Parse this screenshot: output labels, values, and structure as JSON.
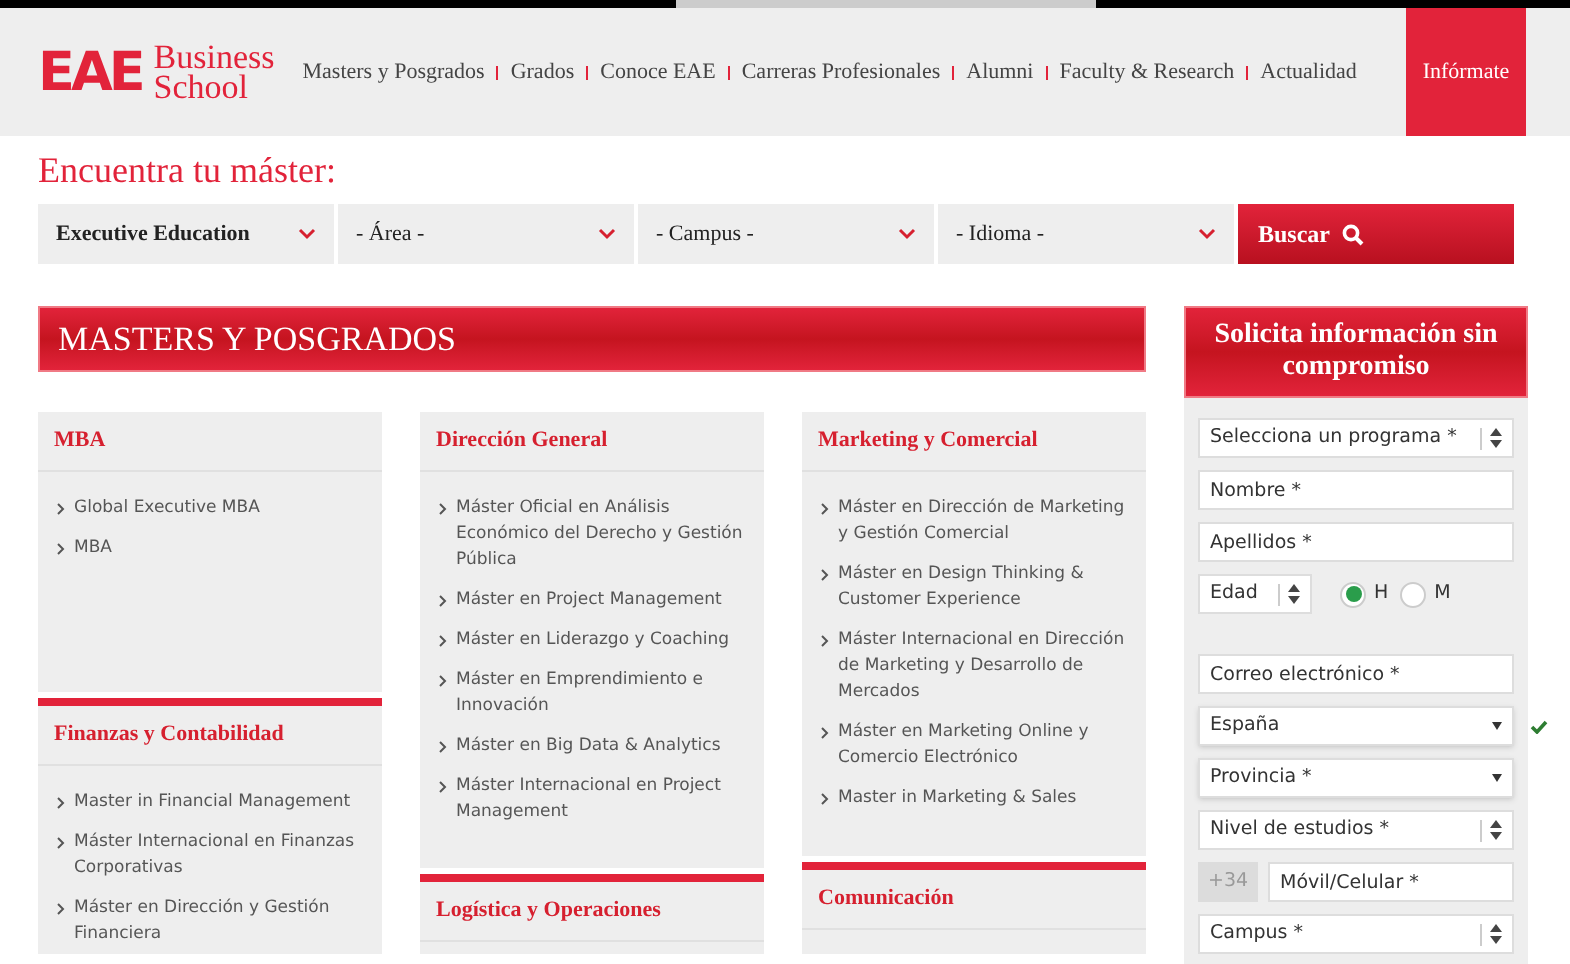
{
  "header": {
    "logo": {
      "mark": "EAE",
      "line1": "Business",
      "line2": "School"
    },
    "nav": [
      {
        "label": "Masters y Posgrados"
      },
      {
        "label": "Grados"
      },
      {
        "label": "Conoce EAE"
      },
      {
        "label": "Carreras Profesionales"
      },
      {
        "label": "Alumni"
      },
      {
        "label": "Faculty & Research"
      },
      {
        "label": "Actualidad"
      }
    ],
    "cta": "Infórmate"
  },
  "finder": {
    "title": "Encuentra tu máster:",
    "filters": [
      {
        "value": "Executive Education",
        "bold": true
      },
      {
        "value": "- Área -",
        "bold": false
      },
      {
        "value": "- Campus -",
        "bold": false
      },
      {
        "value": "- Idioma -",
        "bold": false
      }
    ],
    "button": "Buscar"
  },
  "masters": {
    "title": "MASTERS Y POSGRADOS",
    "columns": [
      [
        {
          "title": "MBA",
          "items": [
            "Global Executive MBA",
            "MBA"
          ]
        },
        {
          "title": "Finanzas y Contabilidad",
          "items": [
            "Master in Financial Management",
            "Máster Internacional en Finanzas Corporativas",
            "Máster en Dirección y Gestión Financiera"
          ]
        }
      ],
      [
        {
          "title": "Dirección General",
          "items": [
            "Máster Oficial en Análisis Económico del Derecho y Gestión Pública",
            "Máster en Project Management",
            "Máster en Liderazgo y Coaching",
            "Máster en Emprendimiento e Innovación",
            "Máster en Big Data & Analytics",
            "Máster Internacional en Project Management"
          ]
        },
        {
          "title": "Logística y Operaciones"
        }
      ],
      [
        {
          "title": "Marketing y Comercial",
          "items": [
            "Máster en Dirección de Marketing y Gestión Comercial",
            "Máster en Design Thinking & Customer Experience",
            "Máster Internacional en Dirección de Marketing y Desarrollo de Mercados",
            "Máster en Marketing Online y Comercio Electrónico",
            "Master in Marketing & Sales"
          ]
        },
        {
          "title": "Comunicación"
        }
      ]
    ]
  },
  "form": {
    "title": "Solicita información sin compromiso",
    "fields": [
      {
        "kind": "spinner",
        "value": "Selecciona un programa *"
      },
      {
        "kind": "input",
        "placeholder": "Nombre *"
      },
      {
        "kind": "input",
        "placeholder": "Apellidos *"
      },
      {
        "kind": "age",
        "value": "Edad",
        "options": [
          {
            "label": "H",
            "selected": true
          },
          {
            "label": "M",
            "selected": false
          }
        ]
      },
      {
        "kind": "input",
        "placeholder": "Correo electrónico *"
      },
      {
        "kind": "dropdown",
        "value": "España",
        "valid": true
      },
      {
        "kind": "dropdown",
        "value": "Provincia *",
        "valid": false
      },
      {
        "kind": "spinner",
        "value": "Nivel de estudios *"
      },
      {
        "kind": "phone",
        "prefix": "+34",
        "placeholder": "Móvil/Celular *"
      },
      {
        "kind": "spinner",
        "value": "Campus *"
      }
    ]
  }
}
